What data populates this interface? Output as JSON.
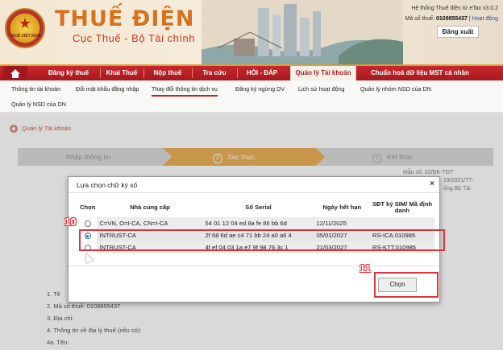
{
  "header": {
    "emblem_text": "THUẾ VIỆT NAM",
    "brand_title": "THUẾ ĐIỆN TỬ",
    "brand_subtitle": "Cục Thuế - Bộ Tài chính",
    "system_name": "Hệ thống Thuế điện tử eTax v3.0.2",
    "tax_code_label": "Mã số thuế:",
    "tax_code_value": "0109855437",
    "separator": "|",
    "activity_link": "Hoạt động",
    "logout_label": "Đăng xuất"
  },
  "main_nav": [
    {
      "label": "Đăng ký thuế"
    },
    {
      "label": "Khai Thuế"
    },
    {
      "label": "Nộp thuế"
    },
    {
      "label": "Tra cứu"
    },
    {
      "label": "HỎI - ĐÁP"
    },
    {
      "label": "Quản lý Tài khoản"
    },
    {
      "label": "Chuẩn hoá dữ liệu MST cá nhân"
    }
  ],
  "sub_nav": [
    {
      "label": "Thông tin tài khoản"
    },
    {
      "label": "Đổi mật khẩu đăng nhập"
    },
    {
      "label": "Thay đổi thông tin dịch vụ"
    },
    {
      "label": "Đăng ký ngừng DV"
    },
    {
      "label": "Lịch sử hoạt động"
    },
    {
      "label": "Quản lý nhóm NSD của DN"
    },
    {
      "label": "Quản lý NSD của DN"
    }
  ],
  "breadcrumb": "Quản lý Tài khoản",
  "steps": [
    {
      "label": "Nhập thông tin"
    },
    {
      "number": "2",
      "label": "Xác thực"
    },
    {
      "number": "3",
      "label": "Kết thúc"
    }
  ],
  "right_note": {
    "line1": "Mẫu số: 02/ĐK-TĐT",
    "line2": "19/2021/TT-",
    "line3": "ống Bộ Tài"
  },
  "form_lines": [
    "1. Tê",
    "2. Mã số thuế: 0109855437",
    "3. Địa chỉ:",
    "4. Thông tin về đại lý thuế (nếu có):",
    "4a. Tên:"
  ],
  "modal": {
    "title": "Lựa chọn chữ ký số",
    "close_symbol": "×",
    "columns": [
      "Chọn",
      "Nhà cung cấp",
      "Số Serial",
      "Ngày hết hạn",
      "SĐT ký SIM/ Mã định danh"
    ],
    "rows": [
      {
        "selected": false,
        "provider": "C=VN, O=I-CA, CN=I-CA",
        "serial": "54 01 12 04 ed 8a fe 86 bb 6d",
        "expiry": "12/11/2025",
        "id": ""
      },
      {
        "selected": true,
        "provider": "INTRUST-CA",
        "serial": "2f 68 6d ae c4 71 bb 24 a0 a6 4",
        "expiry": "05/01/2027",
        "id": "RS-ICA.010985"
      },
      {
        "selected": false,
        "provider": "INTRUST-CA",
        "serial": "4f ef 04 03 1a e7 9f 98 76 3c 1",
        "expiry": "21/03/2027",
        "id": "RS-KTT.010985"
      }
    ],
    "select_button": "Chọn"
  },
  "annotations": {
    "step10": "10",
    "step11": "11"
  },
  "colors": {
    "nav_red": "#b01c20",
    "accent_orange": "#e8a33a",
    "highlight_red": "#e0343c"
  }
}
